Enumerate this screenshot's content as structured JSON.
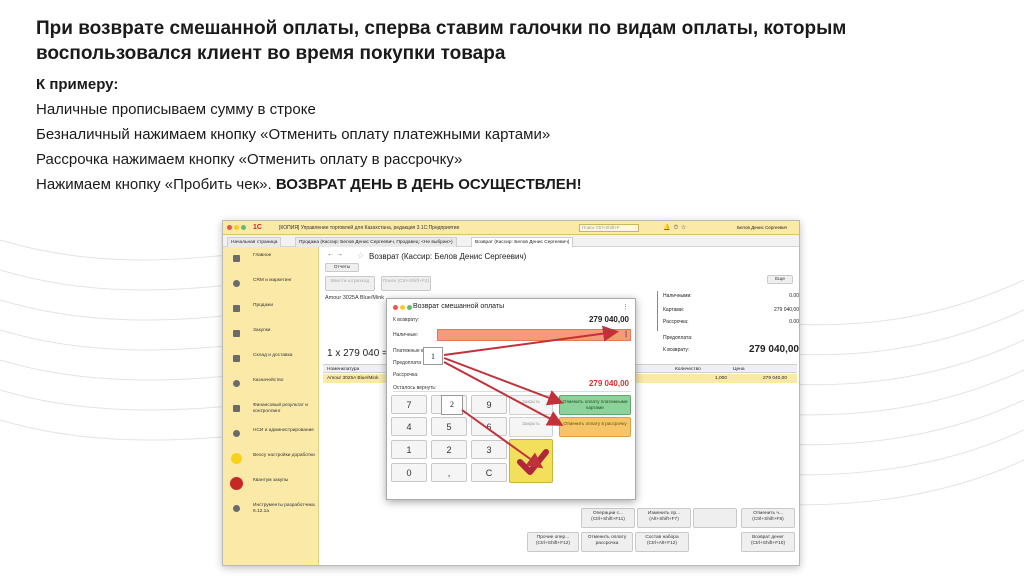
{
  "slide": {
    "title": "При возврате смешанной оплаты, сперва ставим галочки по видам оплаты, которым воспользовался клиент во время покупки товара",
    "example_heading": "К примеру:",
    "lines": [
      "Наличные прописываем сумму в строке",
      "Безналичный нажимаем кнопку «Отменить оплату платежными картами»",
      "Рассрочка нажимаем кнопку «Отменить оплату в рассрочку»"
    ],
    "last_line_prefix": "Нажимаем кнопку «Пробить чек». ",
    "last_line_bold": "ВОЗВРАТ ДЕНЬ В ДЕНЬ ОСУЩЕСТВЛЕН!"
  },
  "app": {
    "logo": "1С",
    "title": "[КОПИЯ] Управление торговлей для Казахстана, редакция 3.1С:Предприятие",
    "search_placeholder": "Поиск Ctrl+Shift+F",
    "user": "Белов Денис Сергеевич",
    "tabs": [
      "Начальная страница",
      "Продажа (Кассир: Белов Денис Сергеевич, Продавец: <Не выбран>)",
      "Возврат (Кассир: Белов Денис Сергеевич)"
    ],
    "sidebar": [
      "Главное",
      "CRM и маркетинг",
      "Продажи",
      "Закупки",
      "Склад и доставка",
      "Казначейство",
      "Финансовый результат и контроллинг",
      "НСИ и администрирование",
      "Веосу настройки доработки",
      "Квантум закупы",
      "Инструменты разработчика 6.12.1а"
    ],
    "doc": {
      "title": "Возврат (Кассир: Белов Денис Сергеевич)",
      "reports_button": "Отчеты",
      "more_button": "Еще",
      "btn_enter_barcode": "Ввести штрихкод",
      "btn_search": "Поиск (Ctrl+Shift+F2)",
      "product_line": "Amour 3025A Blue/Mink",
      "qty_line": "1 x 279 040 =",
      "grid_headers": [
        "Номенклатура",
        "Количество",
        "Цена"
      ],
      "grid_row": {
        "name": "Amour 3025A Blue/Mink",
        "qty": "1,000",
        "price": "279 040,00"
      }
    },
    "summary": {
      "cash_label": "Наличными:",
      "cash": "0.00",
      "cards_label": "Картами:",
      "cards": "279 040,00",
      "installment_label": "Рассрочка:",
      "installment": "0.00",
      "prepay_label": "Предоплата:",
      "to_return_label": "К возврату:",
      "to_return": "279 040,00"
    },
    "bottom_buttons": {
      "operations": "Операции с... (Ctrl+Shift+F11)",
      "change_pr": "Изменить пр... (Alt+Shift+F7)",
      "cancel_sale": "Отменить ч... (Ctrl+Shift+F8)",
      "other_ops": "Прочие опер... (Ctrl+Shift+F12)",
      "cancel_installment": "Отменить оплату рассрочка",
      "set_composition": "Состав набора (Ctrl+Alt+F12)",
      "return_goods": "Возврат денег (Ctrl+Shift+F10)"
    }
  },
  "dialog": {
    "title": "Возврат смешанной оплаты",
    "to_return_label": "К возврату:",
    "to_return": "279 040,00",
    "cash_label": "Наличные:",
    "cards_label": "Платежные к",
    "prepay_label": "Предоплата",
    "installment_label": "Рассрочка:",
    "remaining_label": "Осталось вернуть:",
    "remaining": "279 040,00",
    "keys": [
      "7",
      "8",
      "9",
      "4",
      "5",
      "6",
      "1",
      "2",
      "3",
      "0",
      ",",
      "C"
    ],
    "btn_close": "Закрыть",
    "btn_cancel_cards": "Отменить оплату платежными картами",
    "btn_cancel_installment": "Отменить оплату в рассрочку",
    "popup_digit_1": "1",
    "popup_digit_2": "2"
  },
  "colors": {
    "arrow": "#c0323a",
    "sidebar_bg": "#fbe9a8",
    "cash_field": "#f29c7c",
    "green_btn": "#8dd29a",
    "orange_btn": "#f6c56a",
    "check_btn": "#f2df5c",
    "remaining_red": "#d32f2f"
  }
}
